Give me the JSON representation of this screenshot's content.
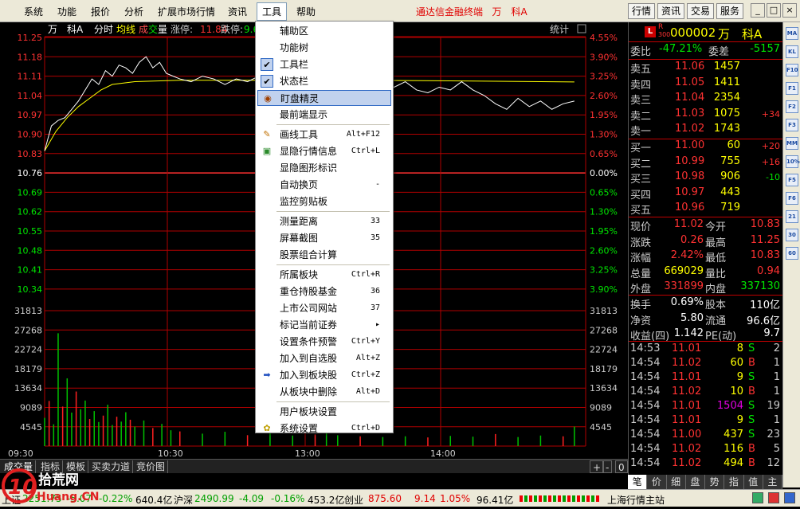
{
  "menubar": {
    "items": [
      "系统",
      "功能",
      "报价",
      "分析",
      "扩展市场行情",
      "资讯",
      "工具",
      "帮助"
    ],
    "app_title": "通达信金融终端",
    "stock_title": "万　科A",
    "right_buttons": [
      "行情",
      "资讯",
      "交易",
      "服务"
    ],
    "win_controls": [
      "_",
      "□",
      "×"
    ]
  },
  "chart_header": {
    "stock": "万　科A",
    "mode": "分时",
    "avg": "均线",
    "vol1": "成",
    "vol2": "交",
    "vol3": "量",
    "limit_up_label": "涨停:",
    "limit_up": "11.84",
    "limit_down_label": "跌停:",
    "limit_down": "9.6",
    "stat": "统计"
  },
  "chart_data": {
    "type": "line",
    "title": "",
    "x_ticks": [
      "09:30",
      "10:30",
      "13:00",
      "14:00"
    ],
    "price_ticks": [
      "11.25",
      "11.18",
      "11.11",
      "11.04",
      "10.97",
      "10.90",
      "10.83",
      "10.76",
      "10.69",
      "10.62",
      "10.55",
      "10.48",
      "10.41",
      "10.34"
    ],
    "pct_ticks": [
      "4.55%",
      "3.90%",
      "3.25%",
      "2.60%",
      "1.95%",
      "1.30%",
      "0.65%",
      "0.00%",
      "0.65%",
      "1.30%",
      "1.95%",
      "2.60%",
      "3.25%",
      "3.90%"
    ],
    "vol_ticks": [
      "31813",
      "27268",
      "22724",
      "18179",
      "13634",
      "9089",
      "4545"
    ],
    "prev_close": 10.76,
    "ylim": [
      10.3,
      11.28
    ],
    "vol_max": 36000,
    "price": [
      [
        0,
        10.84
      ],
      [
        3,
        10.93
      ],
      [
        6,
        10.95
      ],
      [
        9,
        10.96
      ],
      [
        12,
        10.99
      ],
      [
        15,
        11.02
      ],
      [
        18,
        11.06
      ],
      [
        21,
        11.1
      ],
      [
        24,
        11.08
      ],
      [
        27,
        11.13
      ],
      [
        30,
        11.11
      ],
      [
        33,
        11.15
      ],
      [
        36,
        11.14
      ],
      [
        39,
        11.12
      ],
      [
        42,
        11.16
      ],
      [
        45,
        11.18
      ],
      [
        48,
        11.14
      ],
      [
        51,
        11.16
      ],
      [
        54,
        11.12
      ],
      [
        57,
        11.11
      ],
      [
        60,
        11.1
      ],
      [
        65,
        11.09
      ],
      [
        70,
        11.11
      ],
      [
        75,
        11.1
      ],
      [
        80,
        11.08
      ],
      [
        85,
        11.1
      ],
      [
        90,
        11.09
      ],
      [
        95,
        11.11
      ],
      [
        100,
        11.1
      ],
      [
        105,
        11.08
      ],
      [
        110,
        11.1
      ],
      [
        115,
        11.11
      ],
      [
        120,
        11.09
      ],
      [
        125,
        11.1
      ],
      [
        130,
        11.08
      ],
      [
        135,
        11.1
      ],
      [
        140,
        11.09
      ],
      [
        145,
        11.11
      ],
      [
        150,
        11.1
      ],
      [
        155,
        11.07
      ],
      [
        160,
        11.09
      ],
      [
        165,
        11.06
      ],
      [
        170,
        11.05
      ],
      [
        175,
        11.07
      ],
      [
        180,
        11.06
      ],
      [
        185,
        11.09
      ],
      [
        190,
        11.06
      ],
      [
        195,
        11.04
      ],
      [
        200,
        11.01
      ],
      [
        205,
        10.99
      ],
      [
        210,
        11.03
      ],
      [
        215,
        11.0
      ],
      [
        220,
        11.02
      ],
      [
        225,
        10.99
      ],
      [
        230,
        11.01
      ],
      [
        235,
        11.02
      ]
    ],
    "avg_line": [
      [
        0,
        10.84
      ],
      [
        5,
        10.91
      ],
      [
        10,
        10.96
      ],
      [
        15,
        11.0
      ],
      [
        20,
        11.03
      ],
      [
        25,
        11.06
      ],
      [
        30,
        11.08
      ],
      [
        40,
        11.09
      ],
      [
        60,
        11.095
      ],
      [
        100,
        11.095
      ],
      [
        140,
        11.095
      ],
      [
        180,
        11.093
      ],
      [
        210,
        11.091
      ],
      [
        235,
        11.089
      ]
    ],
    "volume": [
      [
        0,
        7500
      ],
      [
        2,
        12000
      ],
      [
        4,
        5800
      ],
      [
        6,
        30000
      ],
      [
        8,
        10500
      ],
      [
        10,
        18000
      ],
      [
        12,
        8900
      ],
      [
        14,
        14500
      ],
      [
        16,
        9800
      ],
      [
        18,
        12100
      ],
      [
        20,
        7200
      ],
      [
        22,
        9300
      ],
      [
        24,
        6400
      ],
      [
        26,
        8100
      ],
      [
        28,
        11000
      ],
      [
        30,
        5600
      ],
      [
        32,
        7800
      ],
      [
        34,
        6500
      ],
      [
        36,
        9000
      ],
      [
        38,
        7000
      ],
      [
        40,
        5200
      ],
      [
        44,
        6800
      ],
      [
        48,
        4800
      ],
      [
        52,
        5900
      ],
      [
        56,
        4200
      ],
      [
        60,
        3900
      ],
      [
        70,
        3300
      ],
      [
        80,
        3800
      ],
      [
        90,
        2900
      ],
      [
        100,
        3400
      ],
      [
        110,
        2800
      ],
      [
        120,
        3100
      ],
      [
        125,
        4500
      ],
      [
        130,
        2900
      ],
      [
        140,
        2600
      ],
      [
        150,
        2400
      ],
      [
        160,
        2600
      ],
      [
        170,
        2300
      ],
      [
        180,
        2700
      ],
      [
        190,
        2500
      ],
      [
        200,
        3200
      ],
      [
        210,
        2400
      ],
      [
        220,
        2800
      ],
      [
        230,
        2600
      ],
      [
        235,
        5200
      ]
    ]
  },
  "context_menu": {
    "items": [
      {
        "label": "辅助区",
        "shortcut": "",
        "icon": ""
      },
      {
        "label": "功能树",
        "shortcut": "",
        "icon": ""
      },
      {
        "label": "工具栏",
        "shortcut": "",
        "icon": "check"
      },
      {
        "label": "状态栏",
        "shortcut": "",
        "icon": "check"
      },
      {
        "label": "盯盘精灵",
        "shortcut": "",
        "icon": "eye"
      },
      {
        "label": "最前端显示",
        "shortcut": "",
        "icon": ""
      },
      {
        "label": "画线工具",
        "shortcut": "Alt+F12",
        "icon": "pencil"
      },
      {
        "label": "显隐行情信息",
        "shortcut": "Ctrl+L",
        "icon": "info"
      },
      {
        "label": "显隐图形标识",
        "shortcut": "",
        "icon": ""
      },
      {
        "label": "自动换页",
        "shortcut": "-",
        "icon": ""
      },
      {
        "label": "监控剪贴板",
        "shortcut": "",
        "icon": ""
      },
      {
        "label": "测量距离",
        "shortcut": "33",
        "icon": ""
      },
      {
        "label": "屏幕截图",
        "shortcut": "35",
        "icon": ""
      },
      {
        "label": "股票组合计算",
        "shortcut": "",
        "icon": ""
      },
      {
        "label": "所属板块",
        "shortcut": "Ctrl+R",
        "icon": ""
      },
      {
        "label": "重仓持股基金",
        "shortcut": "36",
        "icon": ""
      },
      {
        "label": "上市公司网站",
        "shortcut": "37",
        "icon": ""
      },
      {
        "label": "标记当前证券",
        "shortcut": "▸",
        "icon": ""
      },
      {
        "label": "设置条件预警",
        "shortcut": "Ctrl+Y",
        "icon": ""
      },
      {
        "label": "加入到自选股",
        "shortcut": "Alt+Z",
        "icon": ""
      },
      {
        "label": "加入到板块股",
        "shortcut": "Ctrl+Z",
        "icon": "arrow"
      },
      {
        "label": "从板块中删除",
        "shortcut": "Alt+D",
        "icon": ""
      },
      {
        "label": "用户板块设置",
        "shortcut": "",
        "icon": ""
      },
      {
        "label": "系统设置",
        "shortcut": "Ctrl+D",
        "icon": "gear"
      }
    ]
  },
  "quote": {
    "r_badge": "R",
    "l_badge": "L",
    "r_sub": "300",
    "code": "000002",
    "name": "万　科A",
    "wb_label": "委比",
    "wb": "-47.21%",
    "wc_label": "委差",
    "wc": "-5157",
    "sells": [
      {
        "label": "卖五",
        "price": "11.06",
        "vol": "1457",
        "chg": ""
      },
      {
        "label": "卖四",
        "price": "11.05",
        "vol": "1411",
        "chg": ""
      },
      {
        "label": "卖三",
        "price": "11.04",
        "vol": "2354",
        "chg": ""
      },
      {
        "label": "卖二",
        "price": "11.03",
        "vol": "1075",
        "chg": "+34"
      },
      {
        "label": "卖一",
        "price": "11.02",
        "vol": "1743",
        "chg": ""
      }
    ],
    "buys": [
      {
        "label": "买一",
        "price": "11.00",
        "vol": "60",
        "chg": "+20"
      },
      {
        "label": "买二",
        "price": "10.99",
        "vol": "755",
        "chg": "+16"
      },
      {
        "label": "买三",
        "price": "10.98",
        "vol": "906",
        "chg": "-10"
      },
      {
        "label": "买四",
        "price": "10.97",
        "vol": "443",
        "chg": ""
      },
      {
        "label": "买五",
        "price": "10.96",
        "vol": "719",
        "chg": ""
      }
    ],
    "stats": [
      {
        "l1": "现价",
        "v1": "11.02",
        "l2": "今开",
        "v2": "10.83"
      },
      {
        "l1": "涨跌",
        "v1": "0.26",
        "l2": "最高",
        "v2": "11.25"
      },
      {
        "l1": "涨幅",
        "v1": "2.42%",
        "l2": "最低",
        "v2": "10.83"
      },
      {
        "l1": "总量",
        "v1": "669029",
        "l2": "量比",
        "v2": "0.94"
      },
      {
        "l1": "外盘",
        "v1": "331899",
        "l2": "内盘",
        "v2": "337130"
      }
    ],
    "stats2": [
      {
        "l1": "换手",
        "v1": "0.69%",
        "l2": "股本",
        "v2": "110亿"
      },
      {
        "l1": "净资",
        "v1": "5.80",
        "l2": "流通",
        "v2": "96.6亿"
      },
      {
        "l1": "收益(四)",
        "v1": "1.142",
        "l2": "PE(动)",
        "v2": "9.7"
      }
    ],
    "ticks": [
      {
        "t": "14:53",
        "p": "11.01",
        "v": "8",
        "s": "S",
        "n": "2"
      },
      {
        "t": "14:54",
        "p": "11.02",
        "v": "60",
        "s": "B",
        "n": "1"
      },
      {
        "t": "14:54",
        "p": "11.01",
        "v": "9",
        "s": "S",
        "n": "1"
      },
      {
        "t": "14:54",
        "p": "11.02",
        "v": "10",
        "s": "B",
        "n": "1"
      },
      {
        "t": "14:54",
        "p": "11.01",
        "v": "1504",
        "s": "S",
        "n": "19"
      },
      {
        "t": "14:54",
        "p": "11.01",
        "v": "9",
        "s": "S",
        "n": "1"
      },
      {
        "t": "14:54",
        "p": "11.00",
        "v": "437",
        "s": "S",
        "n": "23"
      },
      {
        "t": "14:54",
        "p": "11.02",
        "v": "116",
        "s": "B",
        "n": "5"
      },
      {
        "t": "14:54",
        "p": "11.02",
        "v": "494",
        "s": "B",
        "n": "12"
      }
    ]
  },
  "bottom_tabs_left": [
    "成交量",
    "指标",
    "模板",
    "买卖力道",
    "竞价图"
  ],
  "bottom_tabs_right": [
    "笔",
    "价",
    "细",
    "盘",
    "势",
    "指",
    "值",
    "主"
  ],
  "chart_controls": [
    "+",
    "-",
    "0"
  ],
  "status": {
    "sh_label": "上证",
    "sh_val": "2251.75",
    "sh_chg": "-5.07",
    "sh_pct": "-0.22%",
    "sh_amt": "640.4亿",
    "hs_label": "沪深",
    "hs_val": "2490.99",
    "hs_chg": "-4.09",
    "hs_pct": "-0.16%",
    "hs_amt": "453.2亿",
    "cy_label": "创业",
    "cy_val": "875.60",
    "cy_chg": "9.14",
    "cy_pct": "1.05%",
    "cy_amt": "96.41亿",
    "station": "上海行情主站"
  },
  "toolstrip": [
    "MA",
    "KL",
    "F10",
    "F1",
    "F2",
    "F3",
    "MM",
    "10%",
    "F5",
    "F6",
    "21",
    "30",
    "60"
  ],
  "logo": {
    "brand": "10",
    "site": "拾荒网",
    "url": "Huang.CN"
  },
  "colors": {
    "up": "#ff3232",
    "down": "#00e600",
    "menu_sel": "#c1d2ee",
    "avg": "#ffff00",
    "price": "#ffffff",
    "grid": "#b00000",
    "vol": "#00c000",
    "vol_up": "#ff2020",
    "highlight": "#e000e0"
  }
}
